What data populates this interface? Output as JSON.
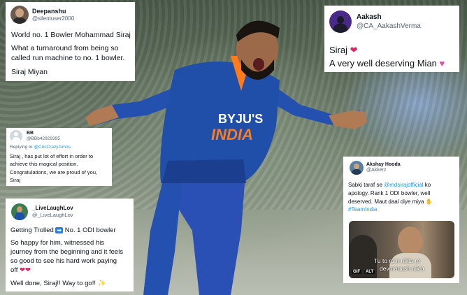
{
  "background": {
    "jersey_sponsor": "BYJU'S",
    "jersey_country": "INDIA",
    "colors": {
      "jersey": "#1f4fa8",
      "accent": "#ff7a1a"
    }
  },
  "tweets": [
    {
      "name": "Deepanshu",
      "handle": "@silentuser2000",
      "lines": [
        "World no. 1 Bowler Mohammad Siraj",
        "What a turnaround from being so",
        "called run machine to no. 1 bowler.",
        "Siraj Miyan"
      ]
    },
    {
      "name": "Aakash",
      "handle": "@CA_AakashVerma",
      "lines": [
        "Siraj",
        "A very well deserving Mian"
      ],
      "emoji": [
        "red-heart",
        "sparkling-heart"
      ]
    },
    {
      "name": "BB",
      "handle": "@BBb42929395",
      "reply_prefix": "Replying to",
      "reply_to": "@CricCrazyJohns",
      "lines": [
        "Siraj , has put lot of effort in order to",
        "achieve this magical position.",
        "Congratulations, we are proud of you,",
        "Siraj"
      ]
    },
    {
      "name": "Akshay Hooda",
      "handle": "@Akkerz",
      "line1_prefix": "Sabki taraf se ",
      "mention": "@mdsirajofficial",
      "line1_suffix": " ko",
      "line2": "apology. Rank 1 ODI bowler, well",
      "line3": "deserved. Maut daal diye miya",
      "hashtag": "#TeamIndia",
      "gif_caption": [
        "Tu to ram nikla re",
        "devmanush nikla"
      ],
      "gif_badges": [
        "GIF",
        "ALT"
      ]
    },
    {
      "name": "_LiveLaughLov",
      "handle": "@_LiveLaughLov",
      "line1_prefix": "Getting Trolled ",
      "line1_suffix": " No. 1 ODI bowler",
      "lines": [
        "So happy for him, witnessed his",
        "journey from the beginning and it feels",
        "so good to see his hard work paying",
        "off"
      ],
      "last_line": "Well done, Siraj!! Way to go!!",
      "emoji": [
        "right-arrow",
        "red-heart",
        "red-heart",
        "dizzy"
      ]
    }
  ]
}
